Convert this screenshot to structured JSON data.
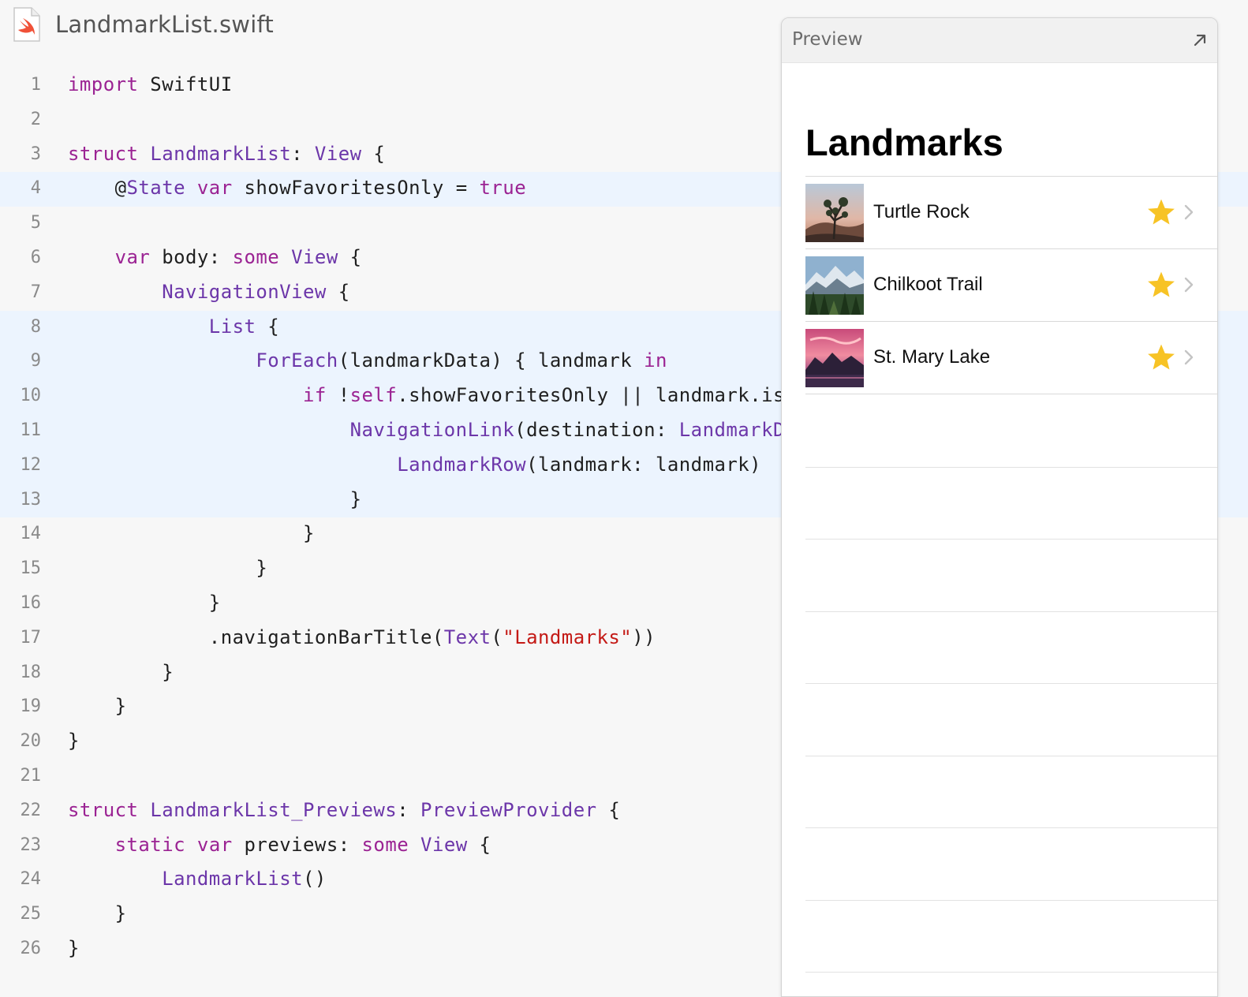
{
  "file": {
    "name": "LandmarkList.swift",
    "icon": "swift-file-icon"
  },
  "code": {
    "lines": [
      {
        "n": "1",
        "hl": false,
        "tokens": [
          [
            "kw",
            "import"
          ],
          [
            "pl",
            " SwiftUI"
          ]
        ]
      },
      {
        "n": "2",
        "hl": false,
        "tokens": []
      },
      {
        "n": "3",
        "hl": false,
        "tokens": [
          [
            "kw",
            "struct"
          ],
          [
            "pl",
            " "
          ],
          [
            "ty",
            "LandmarkList"
          ],
          [
            "pl",
            ": "
          ],
          [
            "ty",
            "View"
          ],
          [
            "pl",
            " {"
          ]
        ]
      },
      {
        "n": "4",
        "hl": true,
        "tokens": [
          [
            "pl",
            "    @"
          ],
          [
            "ty",
            "State"
          ],
          [
            "pl",
            " "
          ],
          [
            "kw",
            "var"
          ],
          [
            "pl",
            " showFavoritesOnly = "
          ],
          [
            "kw",
            "true"
          ]
        ]
      },
      {
        "n": "5",
        "hl": false,
        "tokens": []
      },
      {
        "n": "6",
        "hl": false,
        "tokens": [
          [
            "pl",
            "    "
          ],
          [
            "kw",
            "var"
          ],
          [
            "pl",
            " body: "
          ],
          [
            "kw",
            "some"
          ],
          [
            "pl",
            " "
          ],
          [
            "ty",
            "View"
          ],
          [
            "pl",
            " {"
          ]
        ]
      },
      {
        "n": "7",
        "hl": false,
        "tokens": [
          [
            "pl",
            "        "
          ],
          [
            "ty",
            "NavigationView"
          ],
          [
            "pl",
            " {"
          ]
        ]
      },
      {
        "n": "8",
        "hl": true,
        "tokens": [
          [
            "pl",
            "            "
          ],
          [
            "ty",
            "List"
          ],
          [
            "pl",
            " {"
          ]
        ]
      },
      {
        "n": "9",
        "hl": true,
        "tokens": [
          [
            "pl",
            "                "
          ],
          [
            "ty",
            "ForEach"
          ],
          [
            "pl",
            "(landmarkData) { landmark "
          ],
          [
            "kw",
            "in"
          ]
        ]
      },
      {
        "n": "10",
        "hl": true,
        "tokens": [
          [
            "pl",
            "                    "
          ],
          [
            "kw",
            "if"
          ],
          [
            "pl",
            " !"
          ],
          [
            "kw",
            "self"
          ],
          [
            "pl",
            ".showFavoritesOnly || landmark.isF"
          ]
        ]
      },
      {
        "n": "11",
        "hl": true,
        "tokens": [
          [
            "pl",
            "                        "
          ],
          [
            "ty",
            "NavigationLink"
          ],
          [
            "pl",
            "(destination: "
          ],
          [
            "ty",
            "LandmarkDe"
          ]
        ]
      },
      {
        "n": "12",
        "hl": true,
        "tokens": [
          [
            "pl",
            "                            "
          ],
          [
            "ty",
            "LandmarkRow"
          ],
          [
            "pl",
            "(landmark: landmark)"
          ]
        ]
      },
      {
        "n": "13",
        "hl": true,
        "tokens": [
          [
            "pl",
            "                        }"
          ]
        ]
      },
      {
        "n": "14",
        "hl": false,
        "tokens": [
          [
            "pl",
            "                    }"
          ]
        ]
      },
      {
        "n": "15",
        "hl": false,
        "tokens": [
          [
            "pl",
            "                }"
          ]
        ]
      },
      {
        "n": "16",
        "hl": false,
        "tokens": [
          [
            "pl",
            "            }"
          ]
        ]
      },
      {
        "n": "17",
        "hl": false,
        "tokens": [
          [
            "pl",
            "            .navigationBarTitle("
          ],
          [
            "ty",
            "Text"
          ],
          [
            "pl",
            "("
          ],
          [
            "st",
            "\"Landmarks\""
          ],
          [
            "pl",
            "))"
          ]
        ]
      },
      {
        "n": "18",
        "hl": false,
        "tokens": [
          [
            "pl",
            "        }"
          ]
        ]
      },
      {
        "n": "19",
        "hl": false,
        "tokens": [
          [
            "pl",
            "    }"
          ]
        ]
      },
      {
        "n": "20",
        "hl": false,
        "tokens": [
          [
            "pl",
            "}"
          ]
        ]
      },
      {
        "n": "21",
        "hl": false,
        "tokens": []
      },
      {
        "n": "22",
        "hl": false,
        "tokens": [
          [
            "kw",
            "struct"
          ],
          [
            "pl",
            " "
          ],
          [
            "ty",
            "LandmarkList_Previews"
          ],
          [
            "pl",
            ": "
          ],
          [
            "ty",
            "PreviewProvider"
          ],
          [
            "pl",
            " {"
          ]
        ]
      },
      {
        "n": "23",
        "hl": false,
        "tokens": [
          [
            "pl",
            "    "
          ],
          [
            "kw",
            "static"
          ],
          [
            "pl",
            " "
          ],
          [
            "kw",
            "var"
          ],
          [
            "pl",
            " previews: "
          ],
          [
            "kw",
            "some"
          ],
          [
            "pl",
            " "
          ],
          [
            "ty",
            "View"
          ],
          [
            "pl",
            " {"
          ]
        ]
      },
      {
        "n": "24",
        "hl": false,
        "tokens": [
          [
            "pl",
            "        "
          ],
          [
            "ty",
            "LandmarkList"
          ],
          [
            "pl",
            "()"
          ]
        ]
      },
      {
        "n": "25",
        "hl": false,
        "tokens": [
          [
            "pl",
            "    }"
          ]
        ]
      },
      {
        "n": "26",
        "hl": false,
        "tokens": [
          [
            "pl",
            "}"
          ]
        ]
      }
    ],
    "colors": {
      "keyword": "#9b2393",
      "type": "#6c36a9",
      "string": "#c41a16",
      "plain": "#1f1f1f",
      "highlight_bg": "#ecf4fe"
    }
  },
  "preview": {
    "title": "Preview",
    "expand_icon": "expand-arrow-icon",
    "nav_title": "Landmarks",
    "rows": [
      {
        "name": "Turtle Rock",
        "thumb": "turtle-rock-thumbnail",
        "favorite": true
      },
      {
        "name": "Chilkoot Trail",
        "thumb": "chilkoot-trail-thumbnail",
        "favorite": true
      },
      {
        "name": "St. Mary Lake",
        "thumb": "st-mary-lake-thumbnail",
        "favorite": true
      }
    ],
    "star_color": "#f7c325",
    "empty_rows": 8
  }
}
